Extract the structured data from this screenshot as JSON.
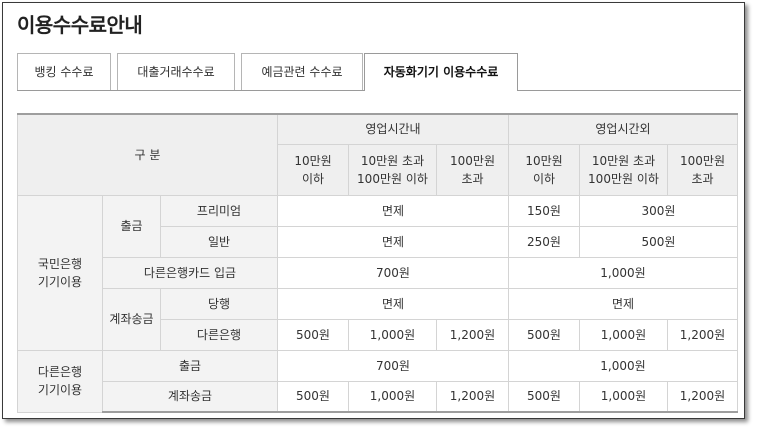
{
  "page": {
    "title": "이용수수료안내"
  },
  "tabs": [
    {
      "label": "뱅킹 수수료",
      "active": false
    },
    {
      "label": "대출거래수수료",
      "active": false
    },
    {
      "label": "예금관련 수수료",
      "active": false
    },
    {
      "label": "자동화기기 이용수수료",
      "active": true
    }
  ],
  "table": {
    "header": {
      "division": "구 분",
      "in_hours": "영업시간내",
      "out_hours": "영업시간외",
      "cols": [
        "10만원\n이하",
        "10만원 초과\n100만원 이하",
        "100만원\n초과",
        "10만원\n이하",
        "10만원 초과\n100만원 이하",
        "100만원\n초과"
      ]
    },
    "kb": {
      "group": "국민은행\n기기이용",
      "withdraw": {
        "label": "출금",
        "premium": {
          "label": "프리미엄",
          "in": "면제",
          "out_low": "150원",
          "out_mid": "300원"
        },
        "normal": {
          "label": "일반",
          "in": "면제",
          "out_low": "250원",
          "out_mid": "500원"
        }
      },
      "other_card_deposit": {
        "label": "다른은행카드 입금",
        "in": "700원",
        "out": "1,000원"
      },
      "transfer": {
        "label": "계좌송금",
        "same": {
          "label": "당행",
          "in": "면제",
          "out": "면제"
        },
        "other": {
          "label": "다른은행",
          "values": [
            "500원",
            "1,000원",
            "1,200원",
            "500원",
            "1,000원",
            "1,200원"
          ]
        }
      }
    },
    "other": {
      "group": "다른은행\n기기이용",
      "withdraw": {
        "label": "출금",
        "in": "700원",
        "out": "1,000원"
      },
      "transfer": {
        "label": "계좌송금",
        "values": [
          "500원",
          "1,000원",
          "1,200원",
          "500원",
          "1,000원",
          "1,200원"
        ]
      }
    }
  }
}
